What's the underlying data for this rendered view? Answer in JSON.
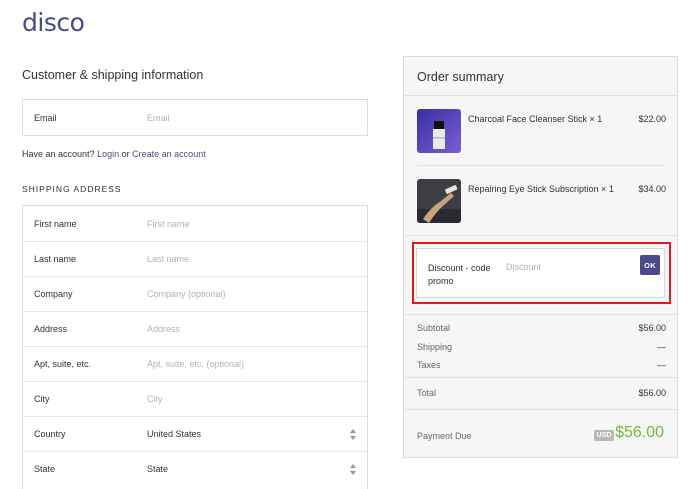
{
  "brand": {
    "logo": "disco",
    "accent": "#4b4a8a"
  },
  "customer": {
    "title": "Customer & shipping information",
    "email_label": "Email",
    "email_placeholder": "Email",
    "account_prefix": "Have an account?",
    "login_link": "Login",
    "or_text": "or",
    "create_link": "Create an account"
  },
  "shipping": {
    "heading": "SHIPPING ADDRESS",
    "fields": [
      {
        "label": "First name",
        "placeholder": "First name"
      },
      {
        "label": "Last name",
        "placeholder": "Last name"
      },
      {
        "label": "Company",
        "placeholder": "Company (optional)"
      },
      {
        "label": "Address",
        "placeholder": "Address"
      },
      {
        "label": "Apt, suite, etc.",
        "placeholder": "Apt, suite, etc. (optional)"
      },
      {
        "label": "City",
        "placeholder": "City"
      }
    ],
    "country_label": "Country",
    "country_value": "United States",
    "state_label": "State",
    "state_value": "State"
  },
  "summary": {
    "title": "Order summary",
    "items": [
      {
        "name": "Charcoal Face Cleanser Stick × 1",
        "price": "$22.00"
      },
      {
        "name": "Repairing Eye Stick Subscription × 1",
        "price": "$34.00"
      }
    ],
    "discount_label": "Discount - code promo",
    "discount_placeholder": "Discount",
    "ok_label": "OK",
    "subtotal_label": "Subtotal",
    "subtotal_value": "$56.00",
    "shipping_label": "Shipping",
    "shipping_value": "—",
    "taxes_label": "Taxes",
    "taxes_value": "—",
    "total_label": "Total",
    "total_value": "$56.00",
    "due_label": "Payment Due",
    "currency": "USD",
    "due_value": "$56.00",
    "due_color": "#7ab63e",
    "highlight_color": "#e0191b"
  }
}
